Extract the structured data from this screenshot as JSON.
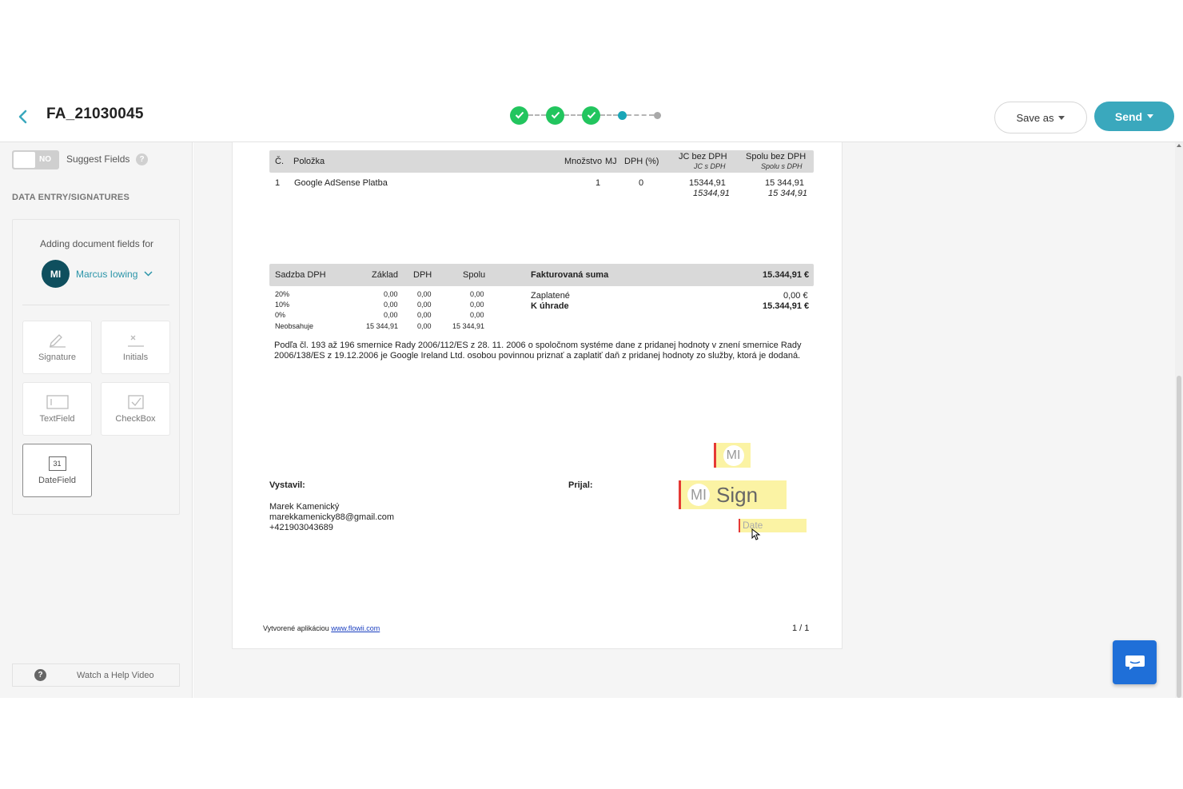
{
  "header": {
    "title": "FA_21030045",
    "save_as_label": "Save as",
    "send_label": "Send",
    "steps": {
      "completed": 3,
      "current": 4,
      "total": 5
    }
  },
  "sidebar": {
    "toggle_label": "NO",
    "suggest_fields_label": "Suggest Fields",
    "help_glyph": "?",
    "section_title": "DATA ENTRY/SIGNATURES",
    "adding_label": "Adding document fields for",
    "signer": {
      "initials": "MI",
      "name": "Marcus Iowing"
    },
    "field_tools": [
      {
        "label": "Signature",
        "icon": "signature-icon"
      },
      {
        "label": "Initials",
        "icon": "initials-icon"
      },
      {
        "label": "TextField",
        "icon": "textfield-icon"
      },
      {
        "label": "CheckBox",
        "icon": "checkbox-icon"
      },
      {
        "label": "DateField",
        "icon": "calendar-icon",
        "icon_text": "31",
        "selected": true
      }
    ],
    "help_video_label": "Watch a Help Video"
  },
  "document": {
    "items_table": {
      "headers": [
        "Č.",
        "Položka",
        "Množstvo",
        "MJ",
        "DPH (%)",
        "JC bez DPH",
        "Spolu bez DPH"
      ],
      "sub_headers": [
        "JC s DPH",
        "Spolu s DPH"
      ],
      "rows": [
        {
          "no": "1",
          "item": "Google AdSense Platba",
          "qty": "1",
          "vat": "0",
          "unit_price": "15344,91",
          "unit_price_vat": "15344,91",
          "total": "15 344,91",
          "total_vat": "15 344,91"
        }
      ]
    },
    "vat_table": {
      "headers": [
        "Sadzba DPH",
        "Základ",
        "DPH",
        "Spolu"
      ],
      "rows": [
        [
          "20%",
          "0,00",
          "0,00",
          "0,00"
        ],
        [
          "10%",
          "0,00",
          "0,00",
          "0,00"
        ],
        [
          "0%",
          "0,00",
          "0,00",
          "0,00"
        ],
        [
          "Neobsahuje",
          "15 344,91",
          "0,00",
          "15 344,91"
        ]
      ]
    },
    "summary": {
      "title": "Fakturovaná suma",
      "title_value": "15.344,91 €",
      "paid_label": "Zaplatené",
      "paid_value": "0,00 €",
      "due_label": "K úhrade",
      "due_value": "15.344,91 €"
    },
    "legal_text": "Podľa čl. 193 až 196 smernice Rady 2006/112/ES z 28. 11. 2006 o spoločnom systéme dane z pridanej hodnoty v znení smernice Rady 2006/138/ES z 19.12.2006 je Google Ireland Ltd. osobou povinnou priznať a zaplatiť daň z pridanej hodnoty zo služby, ktorá je dodaná.",
    "issued_label": "Vystavil:",
    "received_label": "Prijal:",
    "issuer": {
      "name": "Marek Kamenický",
      "email": "marekkamenicky88@gmail.com",
      "phone": "+421903043689"
    },
    "footer_prefix": "Vytvorené aplikáciou",
    "footer_link": "www.flowii.com",
    "page_number": "1 / 1",
    "placeholders": {
      "initials": "MI",
      "sign_initials": "MI",
      "sign_label": "Sign",
      "date_label": "Date"
    }
  },
  "colors": {
    "accent": "#3aa8bd",
    "step_done": "#22c55e",
    "signer": "#0f4f5e",
    "placeholder_bg": "#fbf3a4",
    "placeholder_border": "#e53935",
    "chat": "#1f6fd8"
  }
}
